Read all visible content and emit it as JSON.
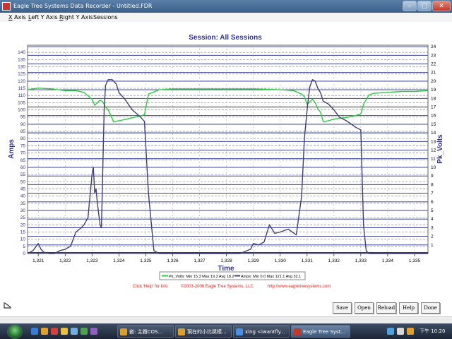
{
  "window": {
    "title": "Eagle Tree Systems Data Recorder - Untitled.FDR"
  },
  "menu": {
    "items": [
      "X Axis",
      "Left Y Axis",
      "Right Y Axis",
      "Sessions"
    ]
  },
  "chart_data": {
    "type": "line",
    "title": "Session: All Sessions",
    "xlabel": "Time",
    "ylabel_left": "Amps",
    "ylabel_right": "Pk_Volts",
    "x_range": [
      1320.6,
      1335.5
    ],
    "x_ticks": [
      1321,
      1322,
      1323,
      1324,
      1325,
      1326,
      1327,
      1328,
      1329,
      1330,
      1331,
      1332,
      1333,
      1334,
      1335
    ],
    "x_tick_labels": [
      "1,321",
      "1,322",
      "1,323",
      "1,324",
      "1,325",
      "1,326",
      "1,327",
      "1,328",
      "1,329",
      "1,330",
      "1,331",
      "1,332",
      "1,333",
      "1,334",
      "1,335"
    ],
    "ylim_left": [
      0,
      145
    ],
    "y_ticks_left": [
      0,
      5,
      10,
      15,
      20,
      25,
      30,
      35,
      40,
      45,
      50,
      55,
      60,
      65,
      70,
      75,
      80,
      85,
      90,
      95,
      100,
      105,
      110,
      115,
      120,
      125,
      130,
      135,
      140
    ],
    "ylim_right": [
      0,
      24.17
    ],
    "y_ticks_right": [
      1,
      2,
      3,
      4,
      5,
      6,
      7,
      8,
      9,
      10,
      11,
      12,
      13,
      14,
      15,
      16,
      17,
      18,
      19,
      20,
      21,
      22,
      23,
      24
    ],
    "grid": true,
    "legend_position": "bottom-center",
    "series": [
      {
        "name": "Pk_Volts",
        "axis": "right",
        "color": "#2ecc40",
        "legend": "Pk_Volts:  Min 15.3 Max 19.3 Avg 18.2",
        "x": [
          1320.6,
          1321.0,
          1321.5,
          1322.0,
          1322.4,
          1322.7,
          1322.85,
          1323.0,
          1323.1,
          1323.2,
          1323.3,
          1323.4,
          1323.5,
          1323.6,
          1323.8,
          1324.0,
          1324.3,
          1324.7,
          1324.85,
          1324.95,
          1325.1,
          1325.5,
          1326.0,
          1327.0,
          1328.0,
          1329.0,
          1330.0,
          1330.5,
          1330.8,
          1330.9,
          1331.0,
          1331.1,
          1331.2,
          1331.3,
          1331.4,
          1331.5,
          1331.6,
          1331.8,
          1332.0,
          1332.5,
          1332.8,
          1333.0,
          1333.1,
          1333.3,
          1333.5,
          1334.0,
          1334.5,
          1335.0,
          1335.5
        ],
        "y": [
          19.0,
          19.2,
          19.1,
          18.9,
          18.9,
          18.7,
          18.3,
          17.9,
          17.2,
          17.5,
          17.8,
          17.6,
          17.0,
          16.7,
          15.3,
          15.4,
          15.6,
          15.9,
          16.0,
          16.1,
          18.5,
          19.0,
          19.1,
          19.1,
          19.1,
          19.1,
          19.0,
          18.9,
          18.5,
          18.2,
          17.3,
          17.6,
          17.9,
          17.5,
          16.8,
          16.4,
          15.3,
          15.4,
          15.6,
          15.8,
          16.0,
          16.2,
          17.3,
          18.4,
          18.6,
          18.7,
          18.8,
          18.8,
          18.9
        ]
      },
      {
        "name": "Amps",
        "axis": "left",
        "color": "#404075",
        "legend": "Amps:  Min 0.0 Max 121.1 Avg 32.1",
        "x": [
          1320.6,
          1320.8,
          1321.0,
          1321.1,
          1321.2,
          1321.4,
          1321.6,
          1321.8,
          1322.0,
          1322.2,
          1322.4,
          1322.6,
          1322.7,
          1322.85,
          1322.95,
          1323.0,
          1323.05,
          1323.1,
          1323.15,
          1323.2,
          1323.3,
          1323.35,
          1323.4,
          1323.45,
          1323.5,
          1323.6,
          1323.75,
          1323.9,
          1324.0,
          1324.2,
          1324.5,
          1324.8,
          1324.95,
          1325.1,
          1325.3,
          1325.5,
          1326.0,
          1327.0,
          1328.0,
          1328.5,
          1328.9,
          1329.0,
          1329.2,
          1329.4,
          1329.6,
          1329.8,
          1330.0,
          1330.3,
          1330.6,
          1330.8,
          1330.9,
          1331.0,
          1331.1,
          1331.2,
          1331.3,
          1331.4,
          1331.5,
          1331.6,
          1331.8,
          1332.0,
          1332.2,
          1332.5,
          1332.8,
          1333.0,
          1333.1,
          1333.2,
          1333.3,
          1333.5,
          1333.7,
          1334.0,
          1334.5,
          1335.0,
          1335.5
        ],
        "y": [
          0,
          2,
          7,
          3,
          1,
          0,
          0,
          2,
          3,
          5,
          15,
          18,
          20,
          25,
          45,
          55,
          60,
          42,
          45,
          35,
          20,
          18,
          60,
          100,
          117,
          121,
          121,
          118,
          112,
          108,
          100,
          95,
          92,
          42,
          2,
          0,
          0,
          0,
          0,
          0,
          3,
          7,
          6,
          8,
          20,
          14,
          15,
          17,
          13,
          40,
          80,
          100,
          116,
          121,
          120,
          115,
          112,
          106,
          104,
          100,
          95,
          92,
          88,
          86,
          20,
          2,
          0,
          0,
          0,
          0,
          0,
          0,
          0
        ]
      }
    ]
  },
  "footer": {
    "help_text": "Click 'Help' for Info",
    "copyright": "©2003-2006 Eagle Tree Systems, LLC",
    "url": "http://www.eagletreesystems.com"
  },
  "buttons": [
    "Save",
    "Open",
    "Reload",
    "Help",
    "Done"
  ],
  "taskbar": {
    "items": [
      {
        "label": "嵌: 主題COS...",
        "icon_color": "#d8a030"
      },
      {
        "label": "現在的小比奨樣...",
        "icon_color": "#d8a030"
      },
      {
        "label": "xing <iwantfly...",
        "icon_color": "#4a90e2"
      },
      {
        "label": "Eagle Tree Syst...",
        "icon_color": "#c0392b"
      }
    ],
    "clock": "下午 10:20"
  }
}
